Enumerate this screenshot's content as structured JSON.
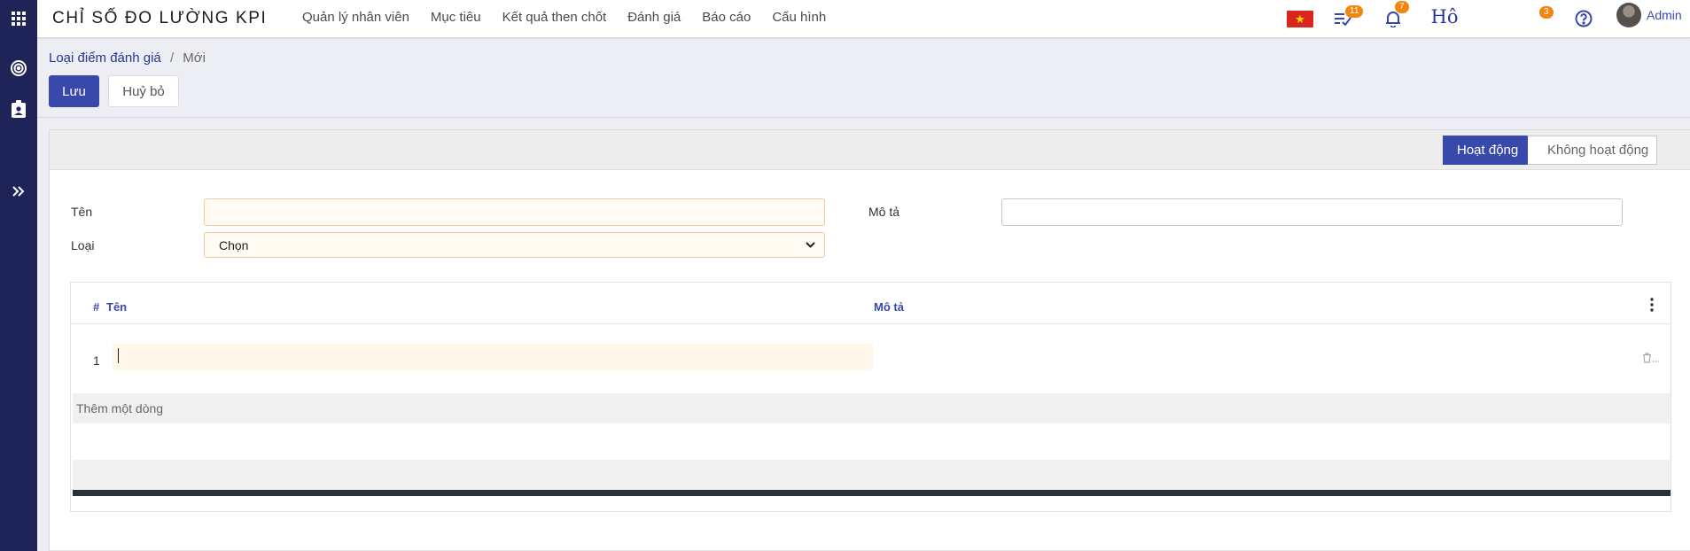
{
  "app": {
    "title": "CHỈ SỐ ĐO LƯỜNG KPI",
    "menu": [
      "Quản lý nhân viên",
      "Mục tiêu",
      "Kết quả then chốt",
      "Đánh giá",
      "Báo cáo",
      "Cấu hình"
    ]
  },
  "header": {
    "activities_count": "11",
    "notifications_count": "7",
    "handwriting_text": "Hô",
    "messages_count": "3",
    "user_name": "Admin"
  },
  "breadcrumb": {
    "parent": "Loại điểm đánh giá",
    "separator": "/",
    "current": "Mới"
  },
  "buttons": {
    "save": "Lưu",
    "discard": "Huỷ bỏ"
  },
  "status": {
    "active": "Hoạt động",
    "inactive": "Không hoạt động"
  },
  "form": {
    "name_label": "Tên",
    "name_value": "",
    "type_label": "Loại",
    "type_selected": "Chọn",
    "desc_label": "Mô tả",
    "desc_value": ""
  },
  "table": {
    "columns": {
      "index": "#",
      "name": "Tên",
      "description": "Mô tả"
    },
    "rows": [
      {
        "index": "1",
        "name": "",
        "description": ""
      }
    ],
    "add_line": "Thêm một dòng"
  },
  "colors": {
    "primary": "#3949ab",
    "sidebar": "#1e2458",
    "badge": "#f0860d",
    "required_bg": "#fffbf2"
  }
}
